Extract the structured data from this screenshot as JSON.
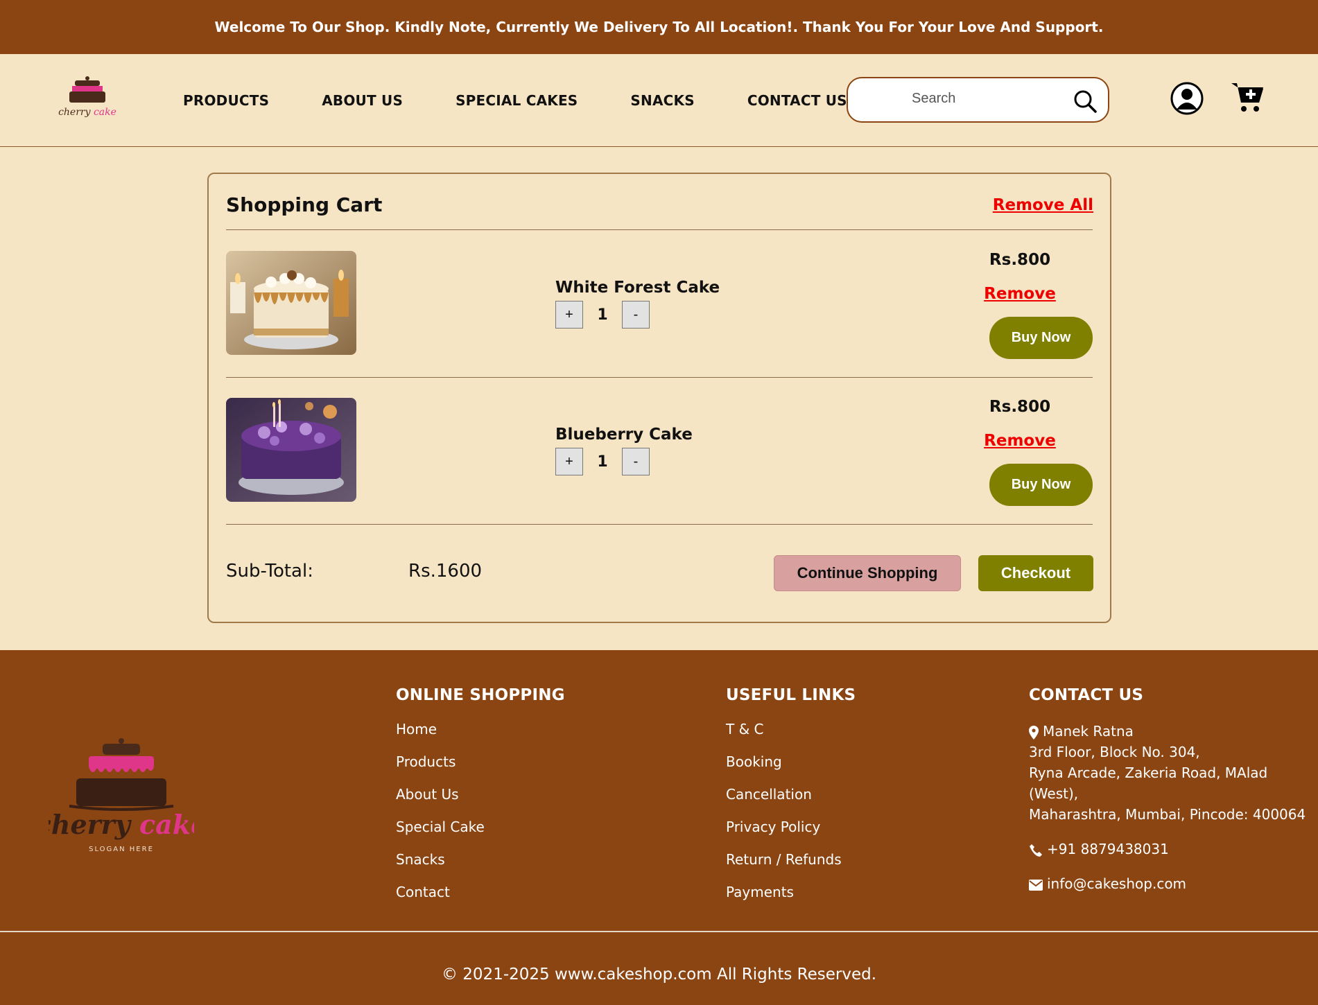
{
  "announcement": "Welcome To Our Shop. Kindly Note, Currently We Delivery To All Location!. Thank You For Your Love And Support.",
  "logo": {
    "brand": "cherry cake",
    "slogan": "SLOGAN HERE"
  },
  "nav": [
    {
      "label": "PRODUCTS"
    },
    {
      "label": "ABOUT US"
    },
    {
      "label": "SPECIAL CAKES"
    },
    {
      "label": "SNACKS"
    },
    {
      "label": "CONTACT US"
    }
  ],
  "search": {
    "placeholder": "Search",
    "icon": "search-icon"
  },
  "header_icons": {
    "account": "user-icon",
    "cart": "cart-add-icon"
  },
  "cart": {
    "title": "Shopping Cart",
    "remove_all": "Remove All",
    "items": [
      {
        "name": "White Forest Cake",
        "qty": "1",
        "price": "Rs.800",
        "remove": "Remove",
        "buy": "Buy Now",
        "plus": "+",
        "minus": "-"
      },
      {
        "name": "Blueberry Cake",
        "qty": "1",
        "price": "Rs.800",
        "remove": "Remove",
        "buy": "Buy Now",
        "plus": "+",
        "minus": "-"
      }
    ],
    "subtotal_label": "Sub-Total:",
    "subtotal_value": "Rs.1600",
    "continue_label": "Continue Shopping",
    "checkout_label": "Checkout"
  },
  "footer": {
    "online_shopping": {
      "heading": "ONLINE SHOPPING",
      "links": [
        "Home",
        "Products",
        "About Us",
        "Special Cake",
        "Snacks",
        "Contact"
      ]
    },
    "useful_links": {
      "heading": "USEFUL LINKS",
      "links": [
        "T & C",
        "Booking",
        "Cancellation",
        "Privacy Policy",
        "Return / Refunds",
        "Payments"
      ]
    },
    "contact": {
      "heading": "CONTACT US",
      "address": [
        "Manek Ratna",
        "3rd Floor, Block No. 304,",
        "Ryna Arcade, Zakeria Road, MAlad (West),",
        "Maharashtra, Mumbai, Pincode: 400064"
      ],
      "phone": "+91 8879438031",
      "email": "info@cakeshop.com"
    },
    "copyright": "© 2021-2025 www.cakeshop.com All Rights Reserved."
  },
  "colors": {
    "brown": "#8b4513",
    "cream": "#f6e5c4",
    "olive": "#808000",
    "pink": "#d9a0a0",
    "red": "#e00000"
  }
}
